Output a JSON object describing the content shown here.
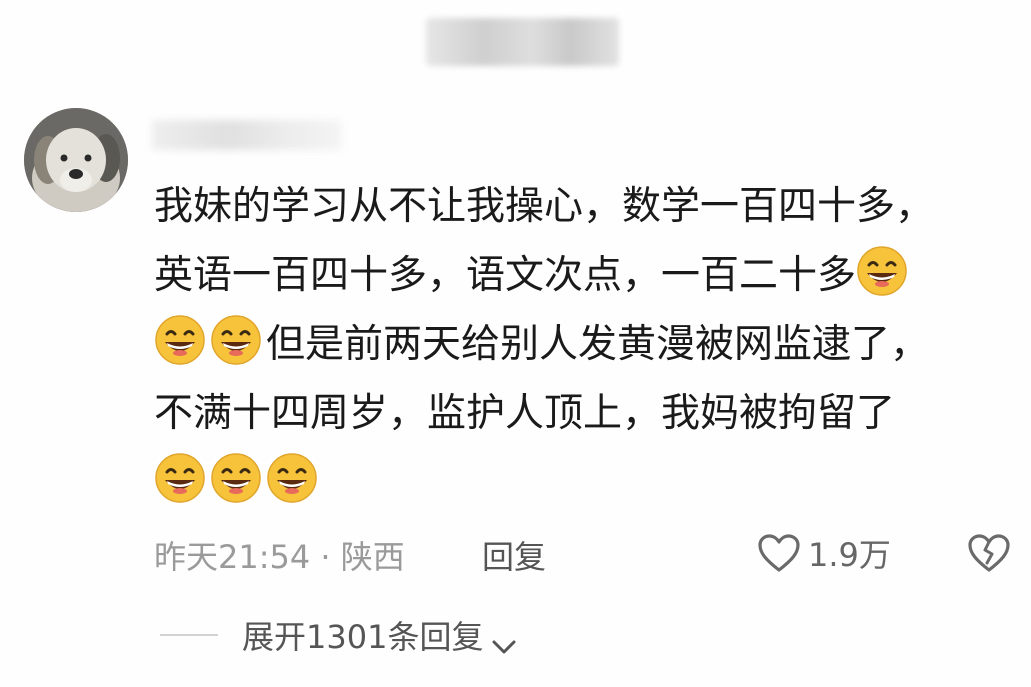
{
  "comment": {
    "lines": [
      [
        "我妹的学习从不让我操心，数学一百四十多，"
      ],
      [
        "英语一百四十多，语文次点，一百二十多",
        "emoji:grin"
      ],
      [
        "emoji:grin",
        "emoji:grin",
        "但是前两天给别人发黄漫被网监逮了，"
      ],
      [
        "不满十四周岁，监护人顶上，我妈被拘留了"
      ],
      [
        "emoji:grin",
        "emoji:grin",
        "emoji:grin"
      ]
    ],
    "line_1": "我妹的学习从不让我操心，数学一百四十多，",
    "line_2": "英语一百四十多，语文次点，一百二十多",
    "line_3": "但是前两天给别人发黄漫被网监逮了，",
    "line_4": "不满十四周岁，监护人顶上，我妈被拘留了"
  },
  "meta": {
    "time_location": "昨天21:54 · 陕西",
    "reply_label": "回复",
    "like_count": "1.9万"
  },
  "expand": {
    "label": "展开1301条回复"
  },
  "icons": {
    "avatar": "plush-dog-avatar",
    "like": "heart-outline-icon",
    "dislike": "broken-heart-icon",
    "expand": "chevron-down-icon",
    "emoji": "grinning-face-emoji"
  },
  "colors": {
    "text": "#1a1a1a",
    "meta": "#9a9a9a",
    "reply": "#555555",
    "emoji_face": "#f7c33b"
  }
}
